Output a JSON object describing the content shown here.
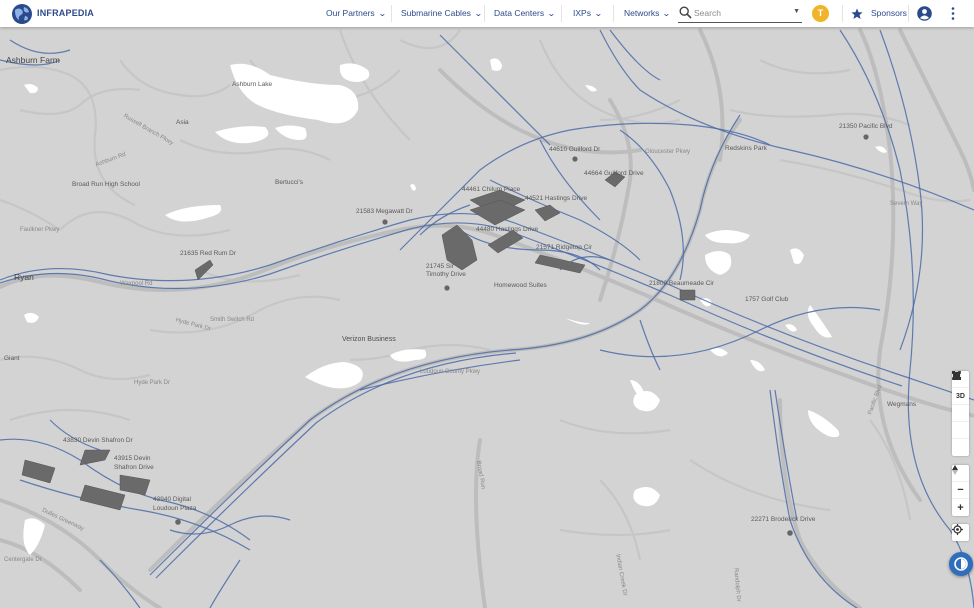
{
  "header": {
    "brand": "INFRAPEDIA",
    "nav": [
      {
        "label": "Our Partners"
      },
      {
        "label": "Submarine Cables"
      },
      {
        "label": "Data Centers"
      },
      {
        "label": "IXPs"
      },
      {
        "label": "Networks"
      }
    ],
    "search_placeholder": "Search",
    "filter_label": "T",
    "sponsors_label": "Sponsors"
  },
  "map": {
    "place_labels": {
      "ashburn_farm": "Ashburn Farm",
      "ryan": "Ryan",
      "giant": "Giant",
      "ashburn_lake": "Ashburn Lake",
      "asia": "Asia",
      "broad_run_hs": "Broad Run High School",
      "bertuccis": "Bertucci's",
      "redskins_park": "Redskins Park",
      "homewood": "Homewood Suites",
      "verizon": "Verizon Business",
      "golf_club": "1757 Golf Club",
      "wegmans": "Wegmans"
    },
    "facility_labels": {
      "a44610": "44610 Guilford Dr",
      "a44664": "44664 Guilford Drive",
      "a44461": "44461 Chilum Place",
      "a44521": "44521 Hastings Drive",
      "a44480": "44480 Hastings Drive",
      "a21583": "21583 Megawatt Dr",
      "a21635": "21635 Red Rum Dr",
      "a21745": "21745 Sir Timothy Drive",
      "a21571": "21571 Ridgetop Cir",
      "a21800": "21800 Beaumeade Cir",
      "a21350": "21350 Pacific Blvd",
      "a43830": "43830 Devin Shafron Dr",
      "a43915": "43915 Devin Shafron Drive",
      "a43940": "43940 Digital Loudoun Plaza",
      "a22271": "22271 Broderick Drive"
    },
    "road_labels": {
      "waxpool": "Waxpool Rd",
      "loudoun_pkwy": "Loudoun County Pkwy",
      "dulles_greenway": "Dulles Greenway",
      "falkner": "Faulkner Pkwy",
      "broad_run": "Broad Run",
      "centergate": "Centergate Dr",
      "hyde_park": "Hyde Park Dr",
      "hyde_park2": "Hyde Park Dr",
      "russell_branch": "Russell Branch Pkwy",
      "ashburn_rd": "Ashburn Rd",
      "pacific_blvd": "Pacific Blvd",
      "gloucester": "Gloucester Pkwy",
      "indian_creek": "Indian Creek Dr",
      "randolph": "Randolph Dr",
      "severn": "Severn Way",
      "smith_switch": "Smith Switch Rd"
    },
    "colors": {
      "land": "#d3d3d3",
      "road": "#bcbcbc",
      "minor_road": "#c6c6c6",
      "fiber": "#4a6aa8",
      "water": "#ffffff",
      "building": "#6a6a6a",
      "marker": "#666666"
    }
  },
  "controls": {
    "fullscreen_icon": "fullscreen-icon",
    "toggle_3d": "3D",
    "trash_icon": "trash-icon",
    "polygon_icon": "polygon-icon",
    "measure_icon": "ruler-icon",
    "compass_icon": "compass-icon",
    "zoom_out": "−",
    "zoom_in": "+",
    "locate_icon": "locate-icon"
  }
}
